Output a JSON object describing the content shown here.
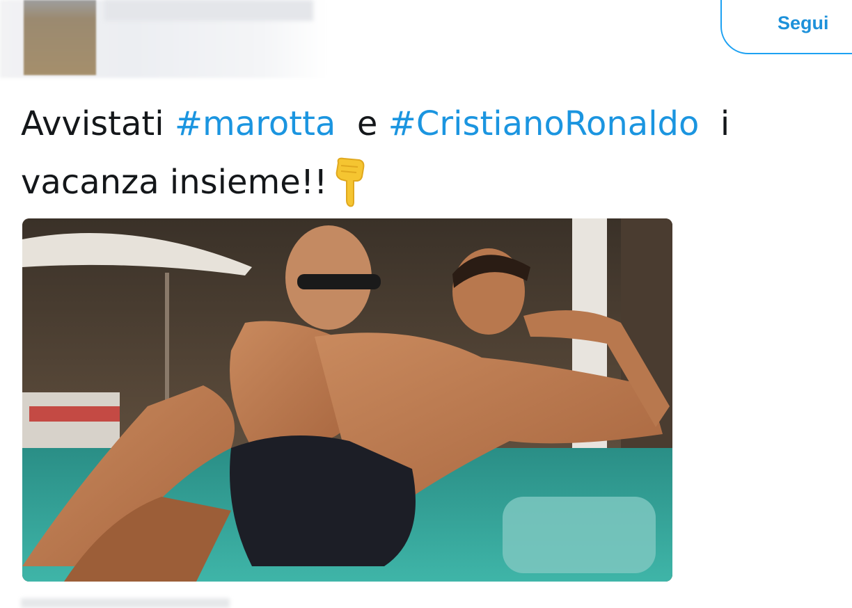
{
  "header": {
    "follow_label": "Segui"
  },
  "tweet": {
    "text_parts": {
      "p1": "Avvistati ",
      "h1": "#marotta",
      "p2": "  e ",
      "h2": "#CristianoRonaldo",
      "p3": "  i",
      "line2": "vacanza insieme!!"
    },
    "emoji": "backhand-index-pointing-down"
  },
  "colors": {
    "hashtag": "#1b95e0",
    "follow_border": "#1da1f2",
    "text": "#14171a"
  }
}
